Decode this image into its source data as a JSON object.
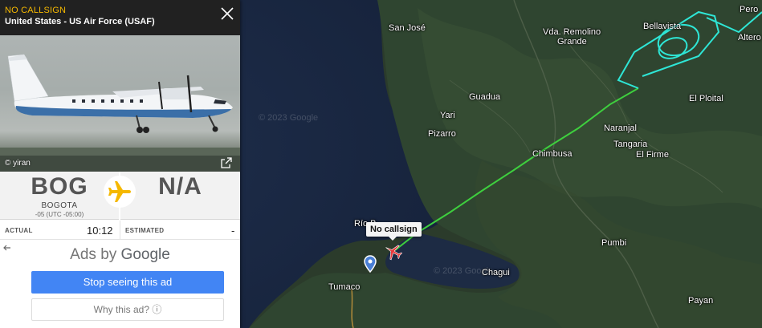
{
  "panel": {
    "callsign": "NO CALLSIGN",
    "operator": "United States - US Air Force (USAF)",
    "close_icon": "close-icon",
    "photo_credit": "© yiran",
    "expand_icon": "external-link-icon"
  },
  "route": {
    "origin_code": "BOG",
    "origin_city": "BOGOTA",
    "origin_tz": "-05 (UTC -05:00)",
    "destination_code": "N/A",
    "plane_icon": "airplane-icon",
    "plane_color": "#f5b800"
  },
  "times": {
    "actual_label": "ACTUAL",
    "actual_value": "10:12",
    "estimated_label": "ESTIMATED",
    "estimated_value": "-"
  },
  "ad": {
    "back_icon": "arrow-left-icon",
    "ads_by_prefix": "Ads by ",
    "ads_by_brand": "Google",
    "stop_label": "Stop seeing this ad",
    "why_label": "Why this ad? ⓘ"
  },
  "map": {
    "tooltip": "No callsign",
    "watermarks": [
      "© 2023 Google",
      "© 2023 Google"
    ],
    "places": [
      "San José",
      "Vda. Remolino",
      "Grande",
      "Bellavista",
      "Pero",
      "Altero",
      "Guadua",
      "Yari",
      "Pizarro",
      "El Ploital",
      "Naranjal",
      "Tangaria",
      "El Firme",
      "Chimbusa",
      "Río B",
      "Chagui",
      "Tumaco",
      "Pumbi",
      "Payan"
    ],
    "track_colors": {
      "green": "#3ecf3e",
      "cyan": "#2ee6d6"
    }
  }
}
